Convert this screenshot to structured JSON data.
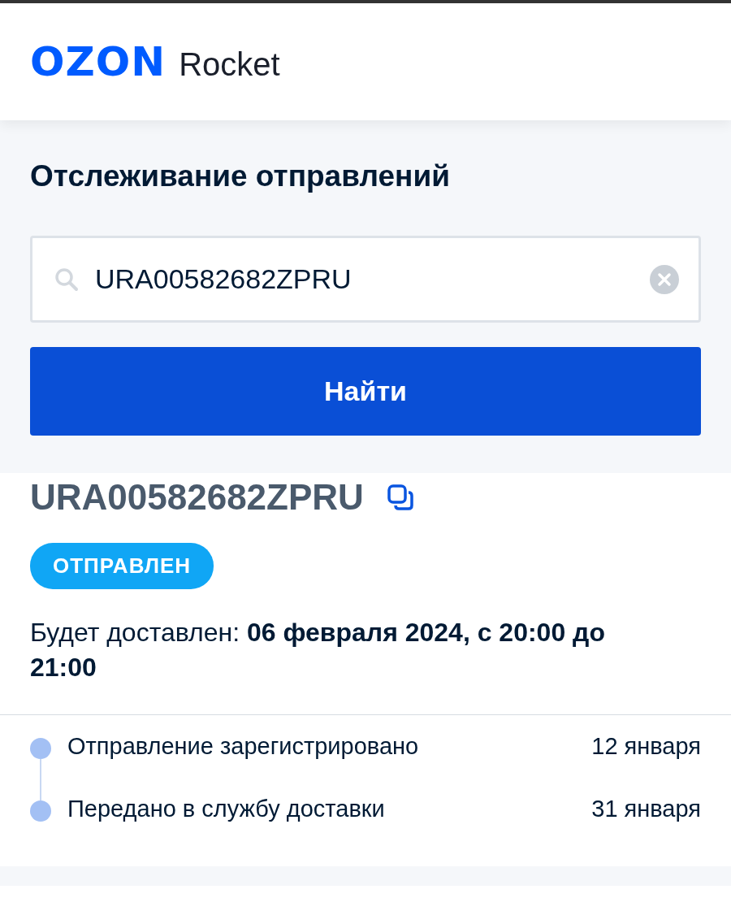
{
  "header": {
    "logo_brand": "OZON",
    "logo_product": "Rocket"
  },
  "search": {
    "title": "Отслеживание отправлений",
    "value": "URA00582682ZPRU",
    "button": "Найти"
  },
  "shipment": {
    "number": "URA00582682ZPRU",
    "status": "ОТПРАВЛЕН",
    "delivery_label": "Будет доставлен:",
    "delivery_value": "06 февраля 2024, с 20:00 до 21:00"
  },
  "history": [
    {
      "event": "Отправление зарегистрировано",
      "date": "12 января"
    },
    {
      "event": "Передано в службу доставки",
      "date": "31 января"
    }
  ]
}
